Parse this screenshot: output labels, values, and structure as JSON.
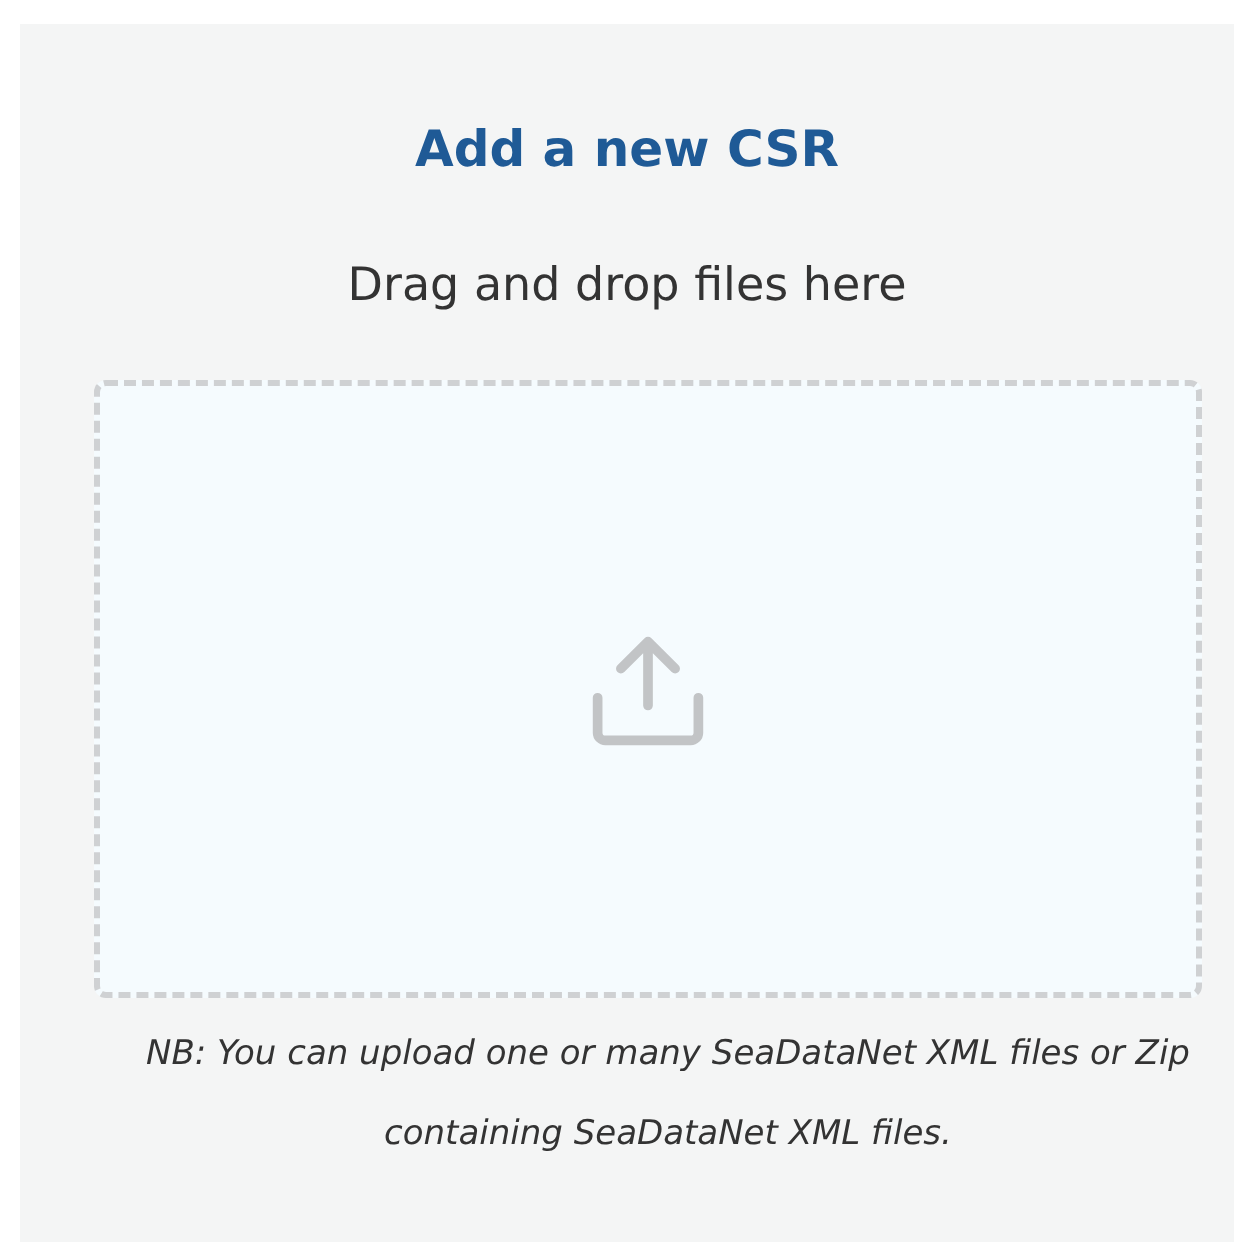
{
  "title": "Add a new CSR",
  "dropzone": {
    "prompt": "Drag and drop files here"
  },
  "note": "NB: You can upload one or many SeaDataNet XML files or Zip containing SeaDataNet XML files."
}
